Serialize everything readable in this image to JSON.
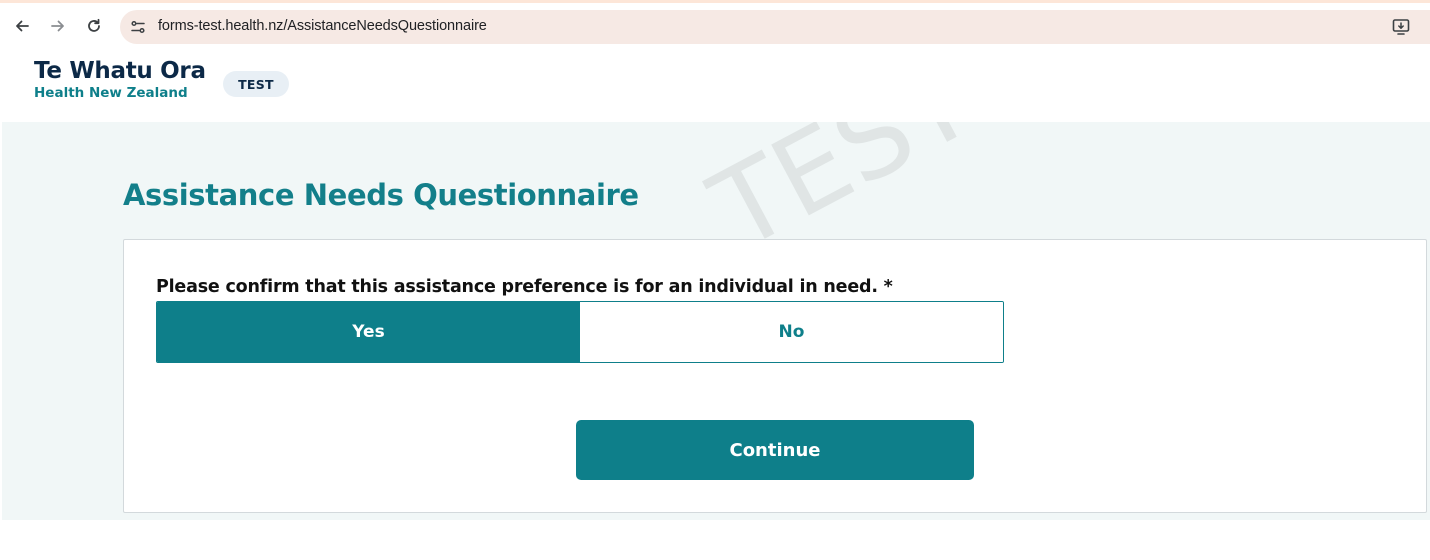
{
  "browser": {
    "url": "forms-test.health.nz/AssistanceNeedsQuestionnaire",
    "back_icon": "back-arrow-icon",
    "forward_icon": "forward-arrow-icon",
    "reload_icon": "reload-icon",
    "site_info_icon": "site-info-icon",
    "install_icon": "install-app-icon"
  },
  "header": {
    "brand_title": "Te Whatu Ora",
    "brand_subtitle": "Health New Zealand",
    "env_badge": "TEST"
  },
  "main": {
    "watermark": "TEST",
    "page_title": "Assistance Needs Questionnaire",
    "question": "Please confirm that this assistance preference is for an individual in need. *",
    "options": [
      {
        "label": "Yes",
        "selected": true
      },
      {
        "label": "No",
        "selected": false
      }
    ],
    "continue_label": "Continue"
  },
  "colors": {
    "primary_teal": "#0e7f8a",
    "brand_navy": "#0c2947",
    "page_bg": "#f1f7f7"
  }
}
